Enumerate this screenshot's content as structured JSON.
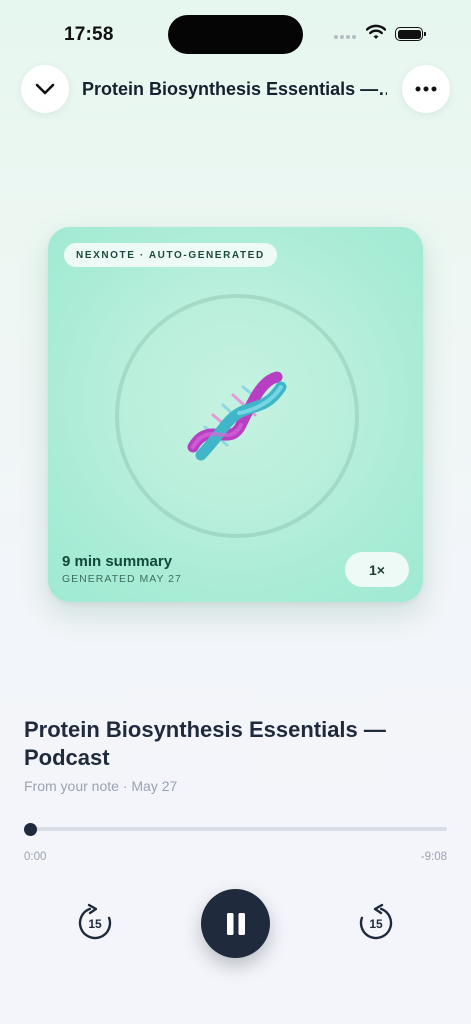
{
  "status_bar": {
    "time": "17:58"
  },
  "nav": {
    "title": "Protein Biosynthesis Essentials —…",
    "back_icon": "chevron-down-icon",
    "more_icon": "ellipsis-icon"
  },
  "artwork": {
    "badge": "NEXNOTE · AUTO-GENERATED",
    "icon": "dna-icon",
    "summary": "9 min summary",
    "generated": "GENERATED MAY 27",
    "speed": "1×"
  },
  "episode": {
    "title": "Protein Biosynthesis Essentials — Podcast",
    "subtitle": "From your note · May 27"
  },
  "playback": {
    "elapsed": "0:00",
    "remaining": "-9:08",
    "progress": 0,
    "rewind_seconds": "15",
    "forward_seconds": "15",
    "state": "playing"
  },
  "colors": {
    "accent": "#1f2a3d",
    "card": "#b9efdc",
    "dna_pink": "#b83fc4",
    "dna_teal": "#3fb7c9"
  }
}
